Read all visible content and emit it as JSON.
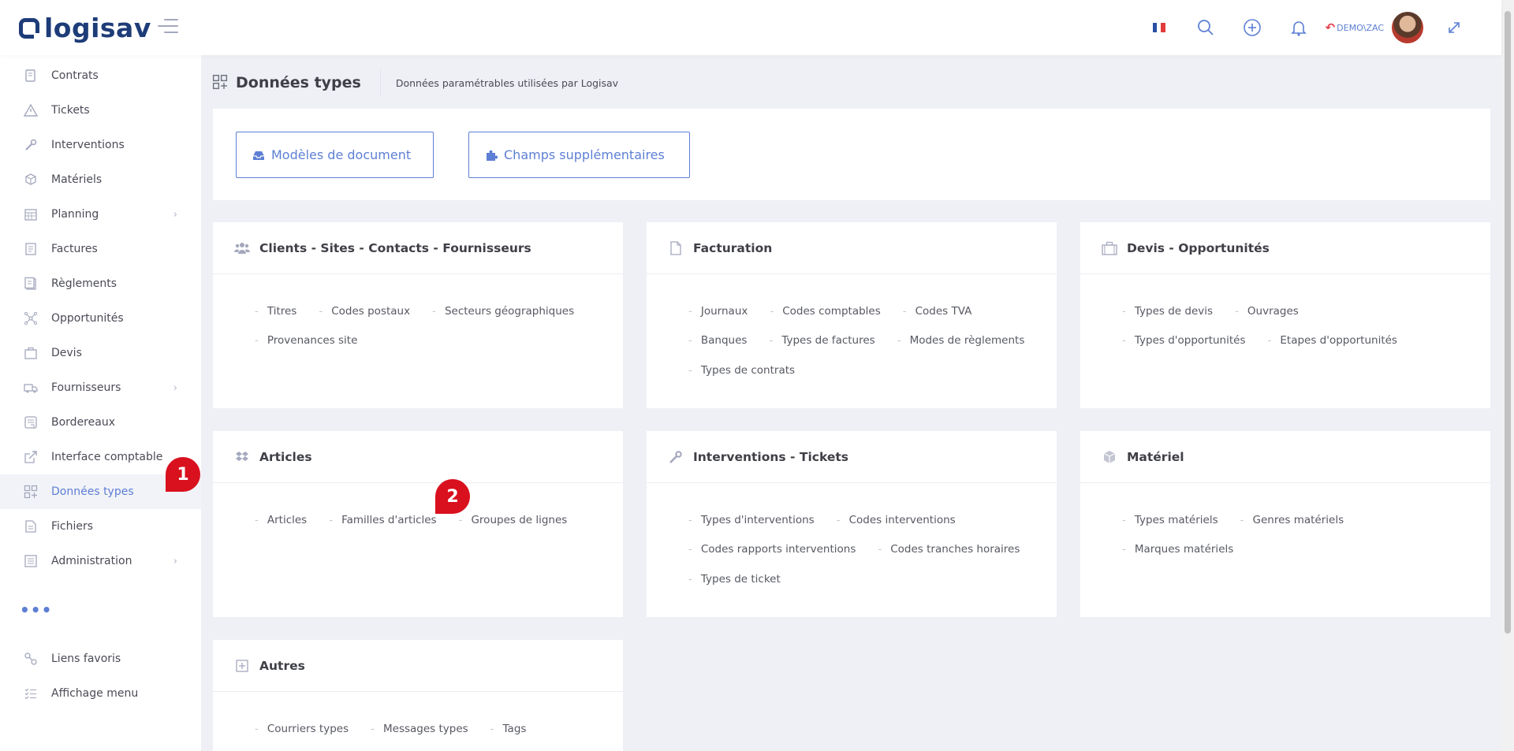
{
  "header": {
    "logo_text": "logisav",
    "user_label": "DEMO\\ZAC"
  },
  "sidebar": {
    "items": [
      {
        "label": "Contrats",
        "icon": "contract-icon",
        "chevron": false,
        "active": false
      },
      {
        "label": "Tickets",
        "icon": "warning-icon",
        "chevron": false,
        "active": false
      },
      {
        "label": "Interventions",
        "icon": "wrench-icon",
        "chevron": false,
        "active": false
      },
      {
        "label": "Matériels",
        "icon": "box-icon",
        "chevron": false,
        "active": false
      },
      {
        "label": "Planning",
        "icon": "calendar-icon",
        "chevron": true,
        "active": false
      },
      {
        "label": "Factures",
        "icon": "invoice-icon",
        "chevron": false,
        "active": false
      },
      {
        "label": "Règlements",
        "icon": "payment-icon",
        "chevron": false,
        "active": false
      },
      {
        "label": "Opportunités",
        "icon": "network-icon",
        "chevron": false,
        "active": false
      },
      {
        "label": "Devis",
        "icon": "briefcase-icon",
        "chevron": false,
        "active": false
      },
      {
        "label": "Fournisseurs",
        "icon": "truck-icon",
        "chevron": true,
        "active": false
      },
      {
        "label": "Bordereaux",
        "icon": "slip-icon",
        "chevron": false,
        "active": false
      },
      {
        "label": "Interface comptable",
        "icon": "external-link-icon",
        "chevron": false,
        "active": false
      },
      {
        "label": "Données types",
        "icon": "grid-plus-icon",
        "chevron": false,
        "active": true
      },
      {
        "label": "Fichiers",
        "icon": "file-icon",
        "chevron": false,
        "active": false
      },
      {
        "label": "Administration",
        "icon": "settings-list-icon",
        "chevron": true,
        "active": false
      }
    ],
    "more": "•••",
    "footer_items": [
      {
        "label": "Liens favoris",
        "icon": "link-icon"
      },
      {
        "label": "Affichage menu",
        "icon": "checklist-icon"
      }
    ]
  },
  "page": {
    "title": "Données types",
    "subtitle": "Données paramétrables utilisées par Logisav"
  },
  "buttons": {
    "models": "Modèles de document",
    "fields": "Champs supplémentaires"
  },
  "cards": [
    {
      "title": "Clients - Sites - Contacts - Fournisseurs",
      "icon": "users-icon",
      "rows": [
        [
          "Titres",
          "Codes postaux",
          "Secteurs géographiques"
        ],
        [
          "Provenances site"
        ]
      ]
    },
    {
      "title": "Facturation",
      "icon": "document-icon",
      "rows": [
        [
          "Journaux",
          "Codes comptables",
          "Codes TVA"
        ],
        [
          "Banques",
          "Types de factures",
          "Modes de règlements"
        ],
        [
          "Types de contrats"
        ]
      ]
    },
    {
      "title": "Devis - Opportunités",
      "icon": "briefcase-icon",
      "rows": [
        [
          "Types de devis",
          "Ouvrages"
        ],
        [
          "Types d'opportunités",
          "Etapes d'opportunités"
        ]
      ]
    },
    {
      "title": "Articles",
      "icon": "dropbox-icon",
      "rows": [
        [
          "Articles",
          "Familles d'articles",
          "Groupes de lignes"
        ]
      ]
    },
    {
      "title": "Interventions - Tickets",
      "icon": "wrench-icon",
      "rows": [
        [
          "Types d'interventions",
          "Codes interventions"
        ],
        [
          "Codes rapports interventions",
          "Codes tranches horaires"
        ],
        [
          "Types de ticket"
        ]
      ]
    },
    {
      "title": "Matériel",
      "icon": "cube-icon",
      "rows": [
        [
          "Types matériels",
          "Genres matériels"
        ],
        [
          "Marques matériels"
        ]
      ]
    },
    {
      "title": "Autres",
      "icon": "plus-square-icon",
      "rows": [
        [
          "Courriers types",
          "Messages types",
          "Tags"
        ]
      ]
    }
  ],
  "annotations": [
    "1",
    "2"
  ],
  "colors": {
    "brand": "#1d3c78",
    "accent": "#5d7fd4",
    "annotation": "#d9101e"
  }
}
